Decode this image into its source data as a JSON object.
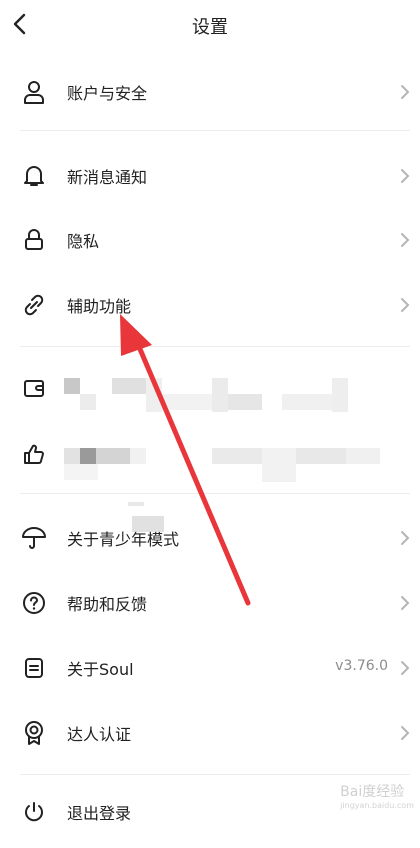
{
  "header": {
    "title": "设置"
  },
  "groups": {
    "account": {
      "label": "账户与安全",
      "icon": "person-icon"
    },
    "notify": {
      "label": "新消息通知",
      "icon": "bell-icon"
    },
    "privacy": {
      "label": "隐私",
      "icon": "lock-icon"
    },
    "a11y": {
      "label": "辅助功能",
      "icon": "link-icon"
    },
    "wallet": {
      "label": "",
      "icon": "wallet-icon"
    },
    "like": {
      "label": "",
      "icon": "thumbs-up-icon"
    },
    "teen": {
      "label": "关于青少年模式",
      "icon": "umbrella-icon"
    },
    "help": {
      "label": "帮助和反馈",
      "icon": "question-icon"
    },
    "about": {
      "label": "关于Soul",
      "value": "v3.76.0",
      "icon": "document-icon"
    },
    "expert": {
      "label": "达人认证",
      "icon": "badge-icon"
    },
    "logout": {
      "label": "退出登录",
      "icon": "power-icon"
    }
  },
  "annotation": {
    "color": "#e8363a"
  },
  "watermark": {
    "text": "Bai度经验",
    "sub": "jingyan.baidu.com"
  }
}
